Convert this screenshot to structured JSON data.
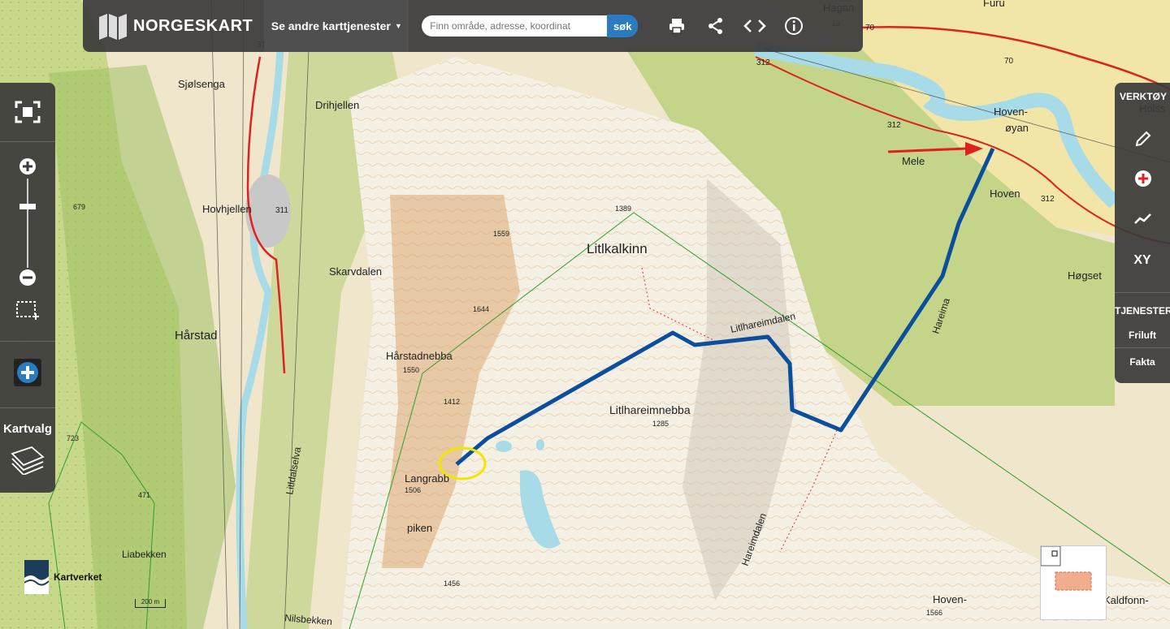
{
  "header": {
    "brand": "NORGESKART",
    "services_label": "Se andre karttjenester",
    "search_placeholder": "Finn område, adresse, koordinat",
    "search_button": "søk"
  },
  "left_panel": {
    "kartvalg_label": "Kartvalg"
  },
  "right_panel": {
    "tools_heading": "VERKTØY",
    "tools_xy": "XY",
    "services_heading": "TJENESTER",
    "service_items": [
      "Friluft",
      "Fakta"
    ]
  },
  "attribution": "Kartverket",
  "scale_label": "200 m",
  "map": {
    "place_names": [
      "Sjølsenga",
      "Drihjellen",
      "Hovhjellen",
      "Skarvdalen",
      "Hårstad",
      "Hårstadnebba",
      "Litlkalkinn",
      "Litlhareimnebba",
      "Langrabb",
      "piken",
      "Mele",
      "Hoven-",
      "øyan",
      "Hoven",
      "Høgset",
      "Furu",
      "Hagan",
      "Hoven-",
      "Kaldfonn-",
      "Holss"
    ],
    "water_names": [
      "Litldalselva",
      "Liabekken",
      "Nilsbekken",
      "Hareima"
    ],
    "valley_names": [
      "Litlhareimdalen",
      "Hareimdalen"
    ],
    "elevations": [
      "1389",
      "1559",
      "1644",
      "1550",
      "1412",
      "1285",
      "1506",
      "1456",
      "1566",
      "679",
      "723",
      "471",
      "13"
    ],
    "road_numbers": [
      "311",
      "311",
      "312",
      "312",
      "312",
      "70",
      "70"
    ],
    "colors": {
      "route": "#0b4e9e",
      "arrow": "#e02020",
      "marker": "#f2e600",
      "water": "#a8dbe8"
    }
  }
}
